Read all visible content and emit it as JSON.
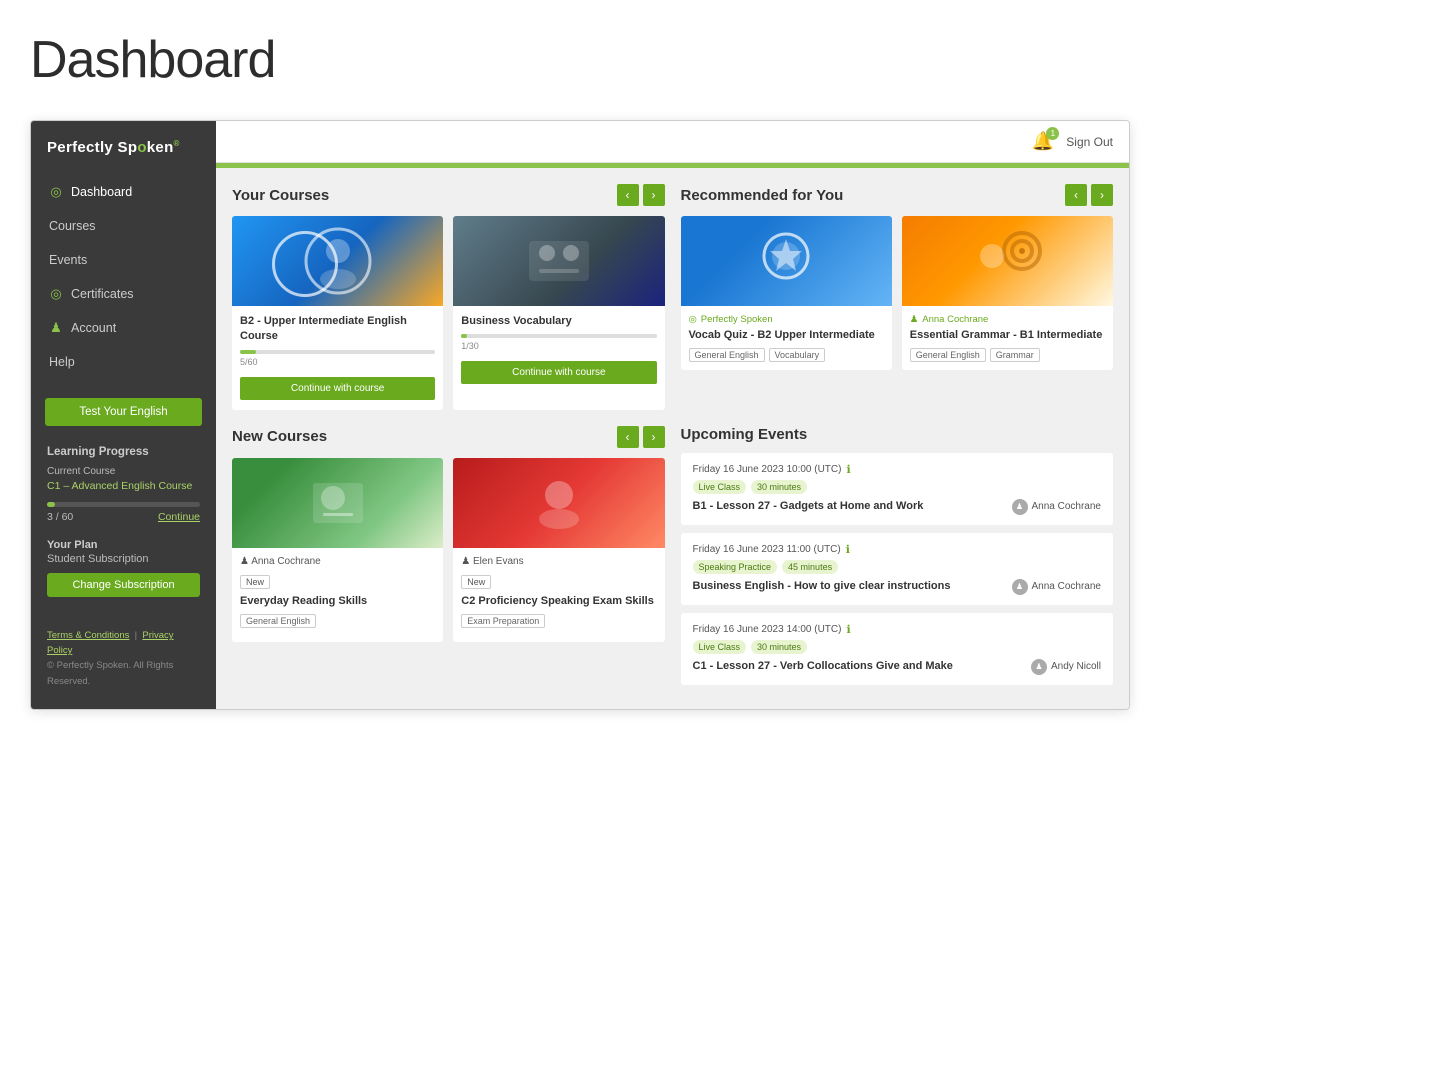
{
  "page": {
    "title": "Dashboard"
  },
  "header": {
    "signout_label": "Sign Out",
    "bell_count": "1"
  },
  "sidebar": {
    "logo": "Perfectly Spoken",
    "logo_accent": "o",
    "nav_items": [
      {
        "id": "dashboard",
        "label": "Dashboard",
        "active": true,
        "has_icon": true
      },
      {
        "id": "courses",
        "label": "Courses",
        "active": false,
        "has_icon": false
      },
      {
        "id": "events",
        "label": "Events",
        "active": false,
        "has_icon": false
      },
      {
        "id": "certificates",
        "label": "Certificates",
        "active": false,
        "has_icon": true
      },
      {
        "id": "account",
        "label": "Account",
        "active": false,
        "has_icon": true
      },
      {
        "id": "help",
        "label": "Help",
        "active": false,
        "has_icon": false
      }
    ],
    "test_btn": "Test Your English",
    "learning_progress_title": "Learning Progress",
    "current_course_label": "Current Course",
    "current_course_name": "C1 – Advanced English Course",
    "progress_fraction": "3 / 60",
    "continue_label": "Continue",
    "progress_percent": 5,
    "plan_title": "Your Plan",
    "plan_value": "Student Subscription",
    "change_btn": "Change Subscription",
    "footer_terms": "Terms & Conditions",
    "footer_privacy": "Privacy Policy",
    "footer_copy": "© Perfectly Spoken. All Rights Reserved."
  },
  "your_courses": {
    "title": "Your Courses",
    "cards": [
      {
        "title": "B2 - Upper Intermediate English Course",
        "progress_pct": 8,
        "progress_text": "5/60",
        "btn_label": "Continue with course"
      },
      {
        "title": "Business Vocabulary",
        "progress_pct": 3,
        "progress_text": "1/30",
        "btn_label": "Continue with course"
      }
    ]
  },
  "recommended": {
    "title": "Recommended for You",
    "cards": [
      {
        "provider": "Perfectly Spoken",
        "title": "Vocab Quiz - B2 Upper Intermediate",
        "tags": [
          "General English",
          "Vocabulary"
        ]
      },
      {
        "provider": "Anna Cochrane",
        "title": "Essential Grammar - B1 Intermediate",
        "tags": [
          "General English",
          "Grammar"
        ]
      }
    ]
  },
  "new_courses": {
    "title": "New Courses",
    "cards": [
      {
        "instructor": "Anna Cochrane",
        "badge": "New",
        "title": "Everyday Reading Skills",
        "tags": [
          "General English"
        ]
      },
      {
        "instructor": "Elen Evans",
        "badge": "New",
        "title": "C2 Proficiency Speaking Exam Skills",
        "tags": [
          "Exam Preparation"
        ]
      }
    ]
  },
  "upcoming_events": {
    "title": "Upcoming Events",
    "events": [
      {
        "date": "Friday 16 June 2023 10:00 (UTC)",
        "tags": [
          "Live Class",
          "30 minutes"
        ],
        "title": "B1 - Lesson 27 - Gadgets at Home and Work",
        "instructor": "Anna Cochrane"
      },
      {
        "date": "Friday 16 June 2023 11:00 (UTC)",
        "tags": [
          "Speaking Practice",
          "45 minutes"
        ],
        "title": "Business English - How to give clear instructions",
        "instructor": "Anna Cochrane"
      },
      {
        "date": "Friday 16 June 2023 14:00 (UTC)",
        "tags": [
          "Live Class",
          "30 minutes"
        ],
        "title": "C1 - Lesson 27 - Verb Collocations Give and Make",
        "instructor": "Andy Nicoll"
      }
    ]
  }
}
